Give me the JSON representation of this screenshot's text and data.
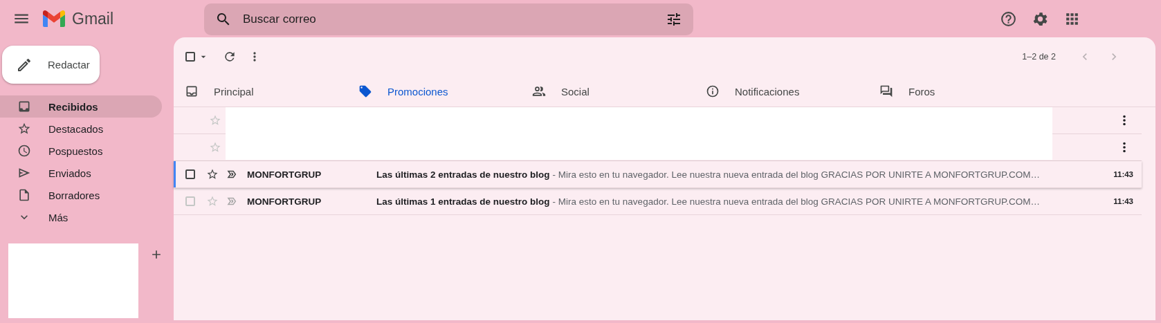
{
  "header": {
    "logo_text": "Gmail",
    "search": {
      "placeholder": "Buscar correo"
    }
  },
  "compose": {
    "label": "Redactar"
  },
  "sidebar": {
    "items": [
      {
        "label": "Recibidos",
        "selected": true
      },
      {
        "label": "Destacados",
        "selected": false
      },
      {
        "label": "Pospuestos",
        "selected": false
      },
      {
        "label": "Enviados",
        "selected": false
      },
      {
        "label": "Borradores",
        "selected": false
      },
      {
        "label": "Más",
        "selected": false
      }
    ]
  },
  "toolbar": {
    "select_all_checked": false,
    "pagination": "1–2 de 2"
  },
  "tabs": [
    {
      "label": "Principal",
      "selected": false
    },
    {
      "label": "Promociones",
      "selected": true
    },
    {
      "label": "Social",
      "selected": false
    },
    {
      "label": "Notificaciones",
      "selected": false
    },
    {
      "label": "Foros",
      "selected": false
    }
  ],
  "emails": [
    {
      "kind": "redacted"
    },
    {
      "kind": "redacted"
    },
    {
      "kind": "message",
      "sender": "MONFORTGRUP",
      "subject": "Las últimas 2 entradas de nuestro blog",
      "snippet": "- Mira esto en tu navegador. Lee nuestra nueva entrada del blog GRACIAS POR UNIRTE A MONFORTGRUP.COM…",
      "time": "11:43",
      "focused": true,
      "checked": false
    },
    {
      "kind": "message",
      "sender": "MONFORTGRUP",
      "subject": "Las últimas 1 entradas de nuestro blog",
      "snippet": "- Mira esto en tu navegador. Lee nuestra nueva entrada del blog GRACIAS POR UNIRTE A MONFORTGRUP.COM…",
      "time": "11:43",
      "focused": false,
      "checked": false
    }
  ]
}
